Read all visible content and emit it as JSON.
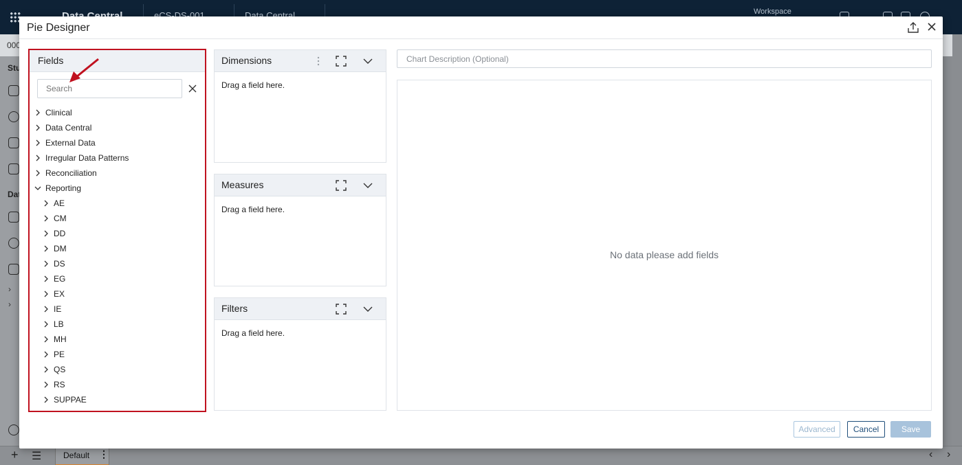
{
  "background": {
    "brand": "Data Central",
    "study_selector": "eCS-DS-001",
    "module_selector": "Data Central",
    "workspace_label": "Workspace",
    "subbar_code": "000",
    "rail_labels": [
      "Stu",
      "Dat"
    ],
    "bottom_tab": "Default"
  },
  "modal": {
    "title": "Pie Designer",
    "export_icon": "export-upload-icon",
    "close_icon": "close-icon"
  },
  "fields": {
    "title": "Fields",
    "search_placeholder": "Search",
    "tree": [
      {
        "label": "Clinical",
        "level": 0,
        "expanded": false
      },
      {
        "label": "Data Central",
        "level": 0,
        "expanded": false
      },
      {
        "label": "External Data",
        "level": 0,
        "expanded": false
      },
      {
        "label": "Irregular Data Patterns",
        "level": 0,
        "expanded": false
      },
      {
        "label": "Reconciliation",
        "level": 0,
        "expanded": false
      },
      {
        "label": "Reporting",
        "level": 0,
        "expanded": true
      },
      {
        "label": "AE",
        "level": 1,
        "expanded": false
      },
      {
        "label": "CM",
        "level": 1,
        "expanded": false
      },
      {
        "label": "DD",
        "level": 1,
        "expanded": false
      },
      {
        "label": "DM",
        "level": 1,
        "expanded": false
      },
      {
        "label": "DS",
        "level": 1,
        "expanded": false
      },
      {
        "label": "EG",
        "level": 1,
        "expanded": false
      },
      {
        "label": "EX",
        "level": 1,
        "expanded": false
      },
      {
        "label": "IE",
        "level": 1,
        "expanded": false
      },
      {
        "label": "LB",
        "level": 1,
        "expanded": false
      },
      {
        "label": "MH",
        "level": 1,
        "expanded": false
      },
      {
        "label": "PE",
        "level": 1,
        "expanded": false
      },
      {
        "label": "QS",
        "level": 1,
        "expanded": false
      },
      {
        "label": "RS",
        "level": 1,
        "expanded": false
      },
      {
        "label": "SUPPAE",
        "level": 1,
        "expanded": false
      }
    ]
  },
  "panels": {
    "dimensions": {
      "title": "Dimensions",
      "hint": "Drag a field here."
    },
    "measures": {
      "title": "Measures",
      "hint": "Drag a field here."
    },
    "filters": {
      "title": "Filters",
      "hint": "Drag a field here."
    }
  },
  "chart": {
    "description_placeholder": "Chart Description (Optional)",
    "empty_message": "No data please add fields"
  },
  "footer": {
    "advanced_label": "Advanced",
    "cancel_label": "Cancel",
    "save_label": "Save"
  },
  "colors": {
    "highlight_border": "#c0111f",
    "primary": "#1f4e7a",
    "disabled_primary": "#a8c3dc",
    "header_bg": "#eef1f5"
  }
}
